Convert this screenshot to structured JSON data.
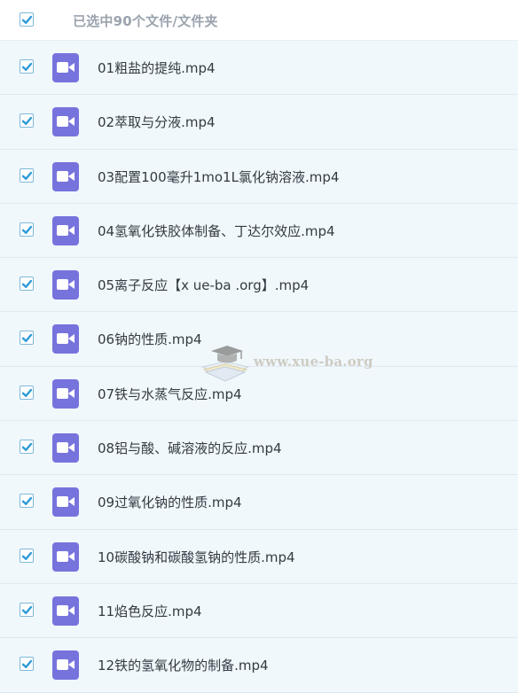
{
  "header": {
    "selection_text": "已选中90个文件/文件夹",
    "select_all_checked": true
  },
  "files": [
    {
      "name": "01粗盐的提纯.mp4",
      "checked": true
    },
    {
      "name": "02萃取与分液.mp4",
      "checked": true
    },
    {
      "name": "03配置100毫升1mo1L氯化钠溶液.mp4",
      "checked": true
    },
    {
      "name": "04氢氧化铁胶体制备、丁达尔效应.mp4",
      "checked": true
    },
    {
      "name": "05离子反应【x ue-ba .org】.mp4",
      "checked": true
    },
    {
      "name": "06钠的性质.mp4",
      "checked": true
    },
    {
      "name": "07铁与水蒸气反应.mp4",
      "checked": true
    },
    {
      "name": "08铝与酸、碱溶液的反应.mp4",
      "checked": true
    },
    {
      "name": "09过氧化钠的性质.mp4",
      "checked": true
    },
    {
      "name": "10碳酸钠和碳酸氢钠的性质.mp4",
      "checked": true
    },
    {
      "name": "11焰色反应.mp4",
      "checked": true
    },
    {
      "name": "12铁的氢氧化物的制备.mp4",
      "checked": true
    }
  ],
  "watermark": {
    "text": "www.xue-ba.org",
    "icon": "graduation-cap-book-icon"
  },
  "colors": {
    "check": "#2d9bd6",
    "video_icon_bg": "#7773dd",
    "row_bg": "#f0f8fc",
    "header_text": "#9aa3ad"
  }
}
